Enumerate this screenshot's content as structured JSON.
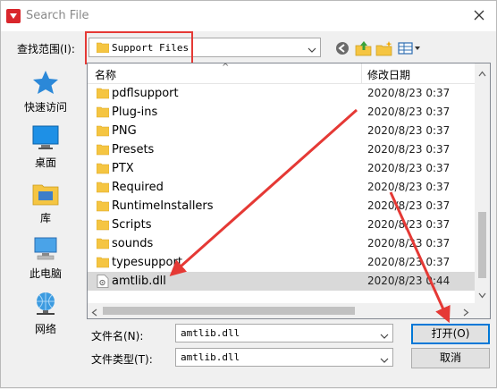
{
  "window": {
    "title": "Search File"
  },
  "lookin": {
    "label": "查找范围(I):",
    "value": "Support Files"
  },
  "places": [
    {
      "label": "快速访问",
      "icon": "star-icon"
    },
    {
      "label": "桌面",
      "icon": "desktop-icon"
    },
    {
      "label": "库",
      "icon": "library-icon"
    },
    {
      "label": "此电脑",
      "icon": "computer-icon"
    },
    {
      "label": "网络",
      "icon": "network-icon"
    }
  ],
  "columns": {
    "name": "名称",
    "date": "修改日期"
  },
  "files": [
    {
      "name": "pdflsupport",
      "date": "2020/8/23 0:37",
      "type": "folder"
    },
    {
      "name": "Plug-ins",
      "date": "2020/8/23 0:37",
      "type": "folder"
    },
    {
      "name": "PNG",
      "date": "2020/8/23 0:37",
      "type": "folder"
    },
    {
      "name": "Presets",
      "date": "2020/8/23 0:37",
      "type": "folder"
    },
    {
      "name": "PTX",
      "date": "2020/8/23 0:37",
      "type": "folder"
    },
    {
      "name": "Required",
      "date": "2020/8/23 0:37",
      "type": "folder"
    },
    {
      "name": "RuntimeInstallers",
      "date": "2020/8/23 0:37",
      "type": "folder"
    },
    {
      "name": "Scripts",
      "date": "2020/8/23 0:37",
      "type": "folder"
    },
    {
      "name": "sounds",
      "date": "2020/8/23 0:37",
      "type": "folder"
    },
    {
      "name": "typesupport",
      "date": "2020/8/23 0:37",
      "type": "folder"
    },
    {
      "name": "amtlib.dll",
      "date": "2020/8/23 0:44",
      "type": "dll",
      "selected": true
    }
  ],
  "filename": {
    "label": "文件名(N):",
    "value": "amtlib.dll"
  },
  "filetype": {
    "label": "文件类型(T):",
    "value": "amtlib.dll"
  },
  "buttons": {
    "open": "打开(O)",
    "cancel": "取消"
  },
  "colors": {
    "annotation": "#e53935",
    "folder": "#f5c542",
    "selection": "#d9d9d9"
  }
}
